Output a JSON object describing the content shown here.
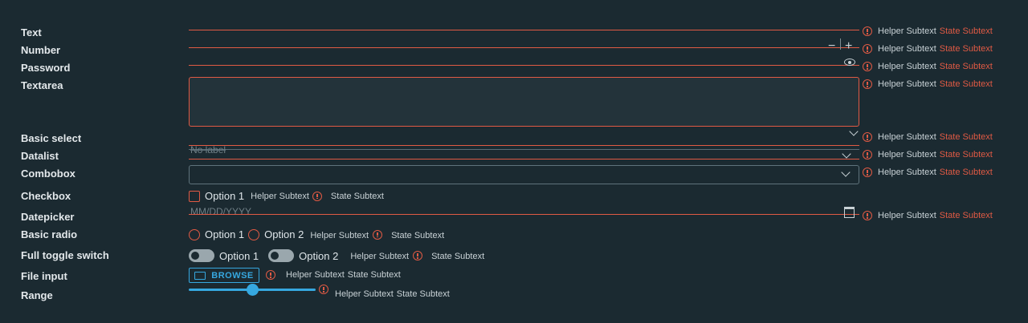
{
  "fields": {
    "text": {
      "label": "Text"
    },
    "number": {
      "label": "Number",
      "minus": "−",
      "plus": "+"
    },
    "password": {
      "label": "Password"
    },
    "textarea": {
      "label": "Textarea"
    },
    "basic_select": {
      "label": "Basic select"
    },
    "datalist": {
      "label": "Datalist",
      "placeholder": "No label"
    },
    "combobox": {
      "label": "Combobox"
    },
    "checkbox": {
      "label": "Checkbox",
      "option": "Option 1"
    },
    "datepicker": {
      "label": "Datepicker",
      "placeholder": "MM/DD/YYYY"
    },
    "basic_radio": {
      "label": "Basic radio",
      "options": [
        "Option 1",
        "Option 2"
      ]
    },
    "toggle": {
      "label": "Full toggle switch",
      "options": [
        "Option 1",
        "Option 2"
      ]
    },
    "file": {
      "label": "File input",
      "button": "BROWSE"
    },
    "range": {
      "label": "Range",
      "value": 0.5
    }
  },
  "helper": "Helper Subtext",
  "state": "State Subtext",
  "colors": {
    "error": "#e05a44",
    "accent": "#36a8e0",
    "background": "#1b2a31"
  }
}
